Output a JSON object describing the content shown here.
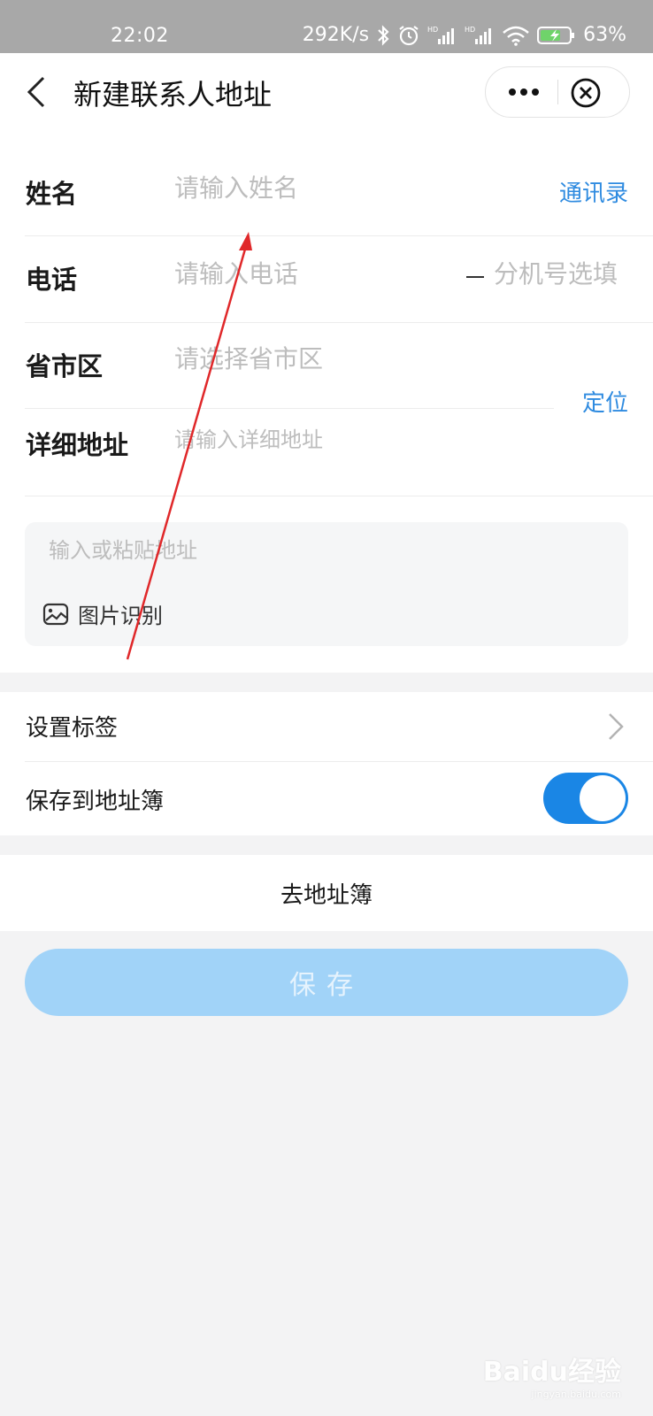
{
  "status_bar": {
    "time": "22:02",
    "network_speed": "292K/s",
    "battery": "63%",
    "icons": [
      "bluetooth-icon",
      "alarm-icon",
      "signal-hd-icon",
      "signal-hd-icon",
      "wifi-icon",
      "battery-charging-icon"
    ]
  },
  "header": {
    "title": "新建联系人地址",
    "back_icon": "chevron-left-icon",
    "more_icon": "more-dots-icon",
    "close_icon": "close-circle-icon"
  },
  "form": {
    "name": {
      "label": "姓名",
      "placeholder": "请输入姓名",
      "link": "通讯录"
    },
    "phone": {
      "label": "电话",
      "placeholder": "请输入电话",
      "ext_placeholder": "分机号选填"
    },
    "region": {
      "label": "省市区",
      "placeholder": "请选择省市区"
    },
    "detail": {
      "label": "详细地址",
      "placeholder": "请输入详细地址"
    },
    "locate_link": "定位",
    "paste": {
      "placeholder": "输入或粘贴地址",
      "image_recognition": "图片识别",
      "image_icon": "image-icon"
    }
  },
  "settings": {
    "tag_label": "设置标签",
    "save_to_book_label": "保存到地址簿",
    "save_to_book_on": true
  },
  "goto_book": "去地址簿",
  "save_button": "保存",
  "colors": {
    "accent": "#1a86e5",
    "link": "#2f8be0",
    "save_disabled": "#a1d3f8",
    "annotation": "#e0282a"
  },
  "watermark": {
    "brand": "Baidu经验",
    "url": "jingyan.baidu.com"
  }
}
